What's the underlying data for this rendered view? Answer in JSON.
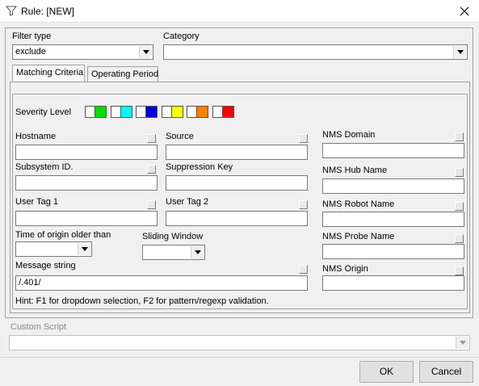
{
  "window": {
    "title": "Rule: [NEW]"
  },
  "filter_type": {
    "label": "Filter type",
    "value": "exclude"
  },
  "category": {
    "label": "Category",
    "value": ""
  },
  "tabs": [
    {
      "label": "Matching Criteria"
    },
    {
      "label": "Operating Period"
    }
  ],
  "severity": {
    "label": "Severity Level",
    "colors": [
      "#00e000",
      "#00ffff",
      "#0000e0",
      "#ffff00",
      "#ff8000",
      "#ff0000"
    ]
  },
  "fields": {
    "hostname": {
      "label": "Hostname",
      "value": ""
    },
    "source": {
      "label": "Source",
      "value": ""
    },
    "subsystem_id": {
      "label": "Subsystem ID.",
      "value": ""
    },
    "suppression_key": {
      "label": "Suppression Key",
      "value": ""
    },
    "user_tag_1": {
      "label": "User Tag 1",
      "value": ""
    },
    "user_tag_2": {
      "label": "User Tag 2",
      "value": ""
    },
    "time_of_origin": {
      "label": "Time of origin older than",
      "value": ""
    },
    "sliding_window": {
      "label": "Sliding Window",
      "value": ""
    },
    "message_string": {
      "label": "Message string",
      "value": "/.401/"
    },
    "nms_domain": {
      "label": "NMS Domain",
      "value": ""
    },
    "nms_hub_name": {
      "label": "NMS Hub Name",
      "value": ""
    },
    "nms_robot_name": {
      "label": "NMS Robot Name",
      "value": ""
    },
    "nms_probe_name": {
      "label": "NMS Probe Name",
      "value": ""
    },
    "nms_origin": {
      "label": "NMS Origin",
      "value": ""
    }
  },
  "hint": "Hint: F1 for dropdown selection, F2 for pattern/regexp validation.",
  "custom_script": {
    "label": "Custom Script",
    "value": ""
  },
  "buttons": {
    "ok": "OK",
    "cancel": "Cancel"
  }
}
